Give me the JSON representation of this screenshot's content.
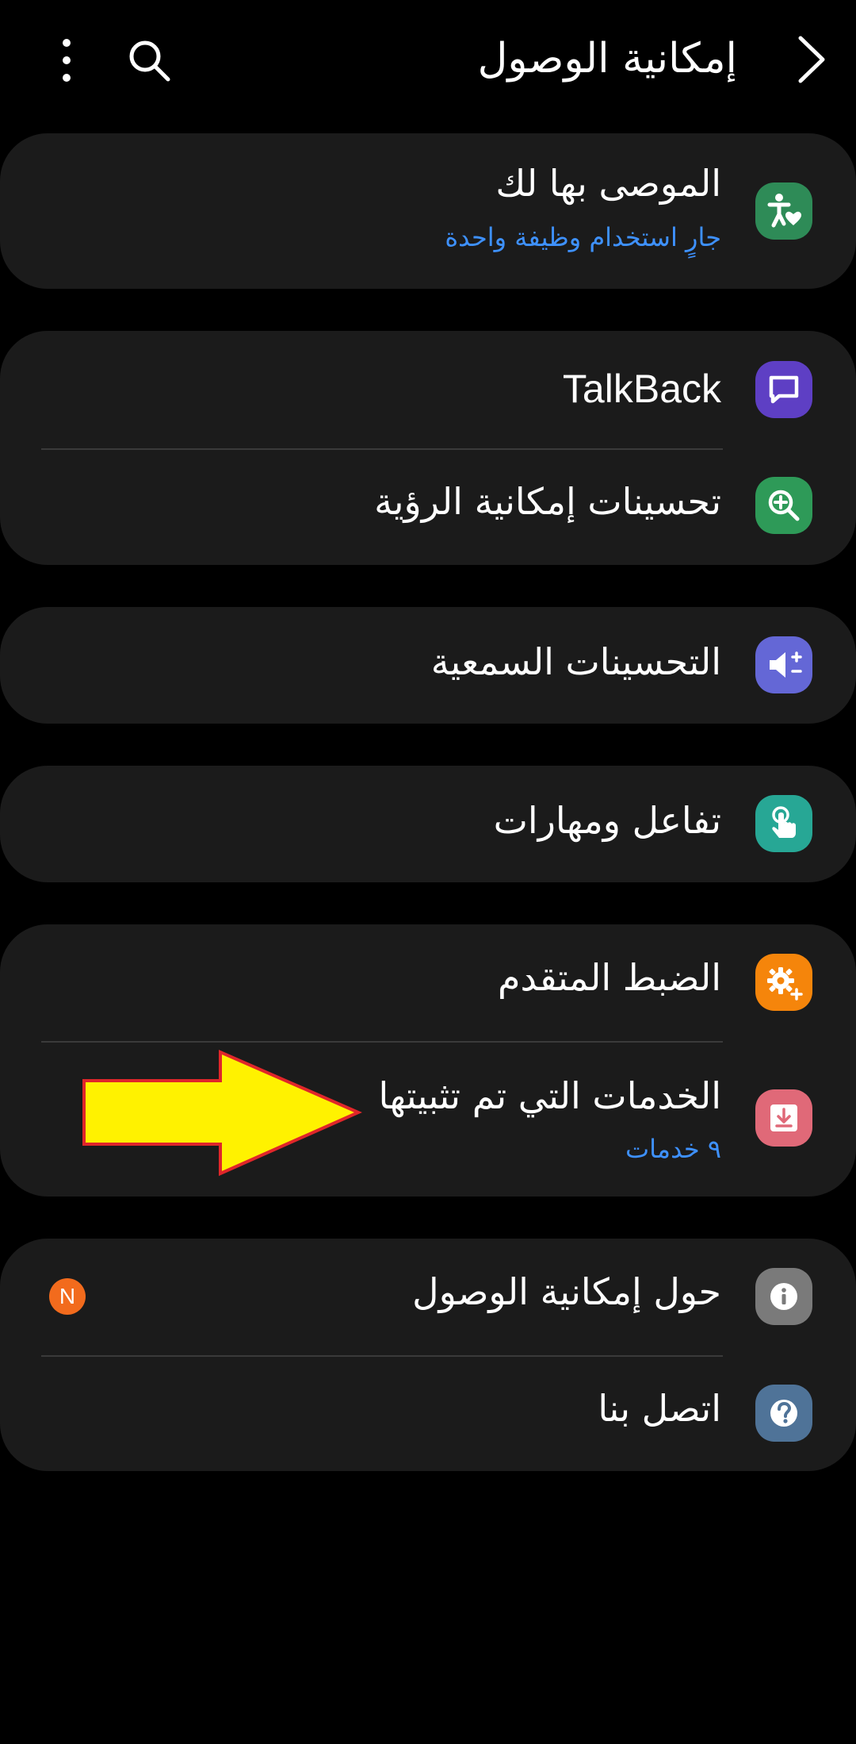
{
  "header": {
    "title": "إمكانية الوصول",
    "back_icon": "chevron-right-icon",
    "search_icon": "search-icon",
    "more_icon": "more-vertical-icon"
  },
  "groups": [
    {
      "items": [
        {
          "label": "الموصى بها لك",
          "subtitle": "جارٍ استخدام وظيفة واحدة",
          "icon": "accessibility-heart-icon",
          "icon_color": "#2e8b57"
        }
      ]
    },
    {
      "items": [
        {
          "label": "TalkBack",
          "icon": "talkback-chat-icon",
          "icon_color": "#5e3fc4"
        },
        {
          "label": "تحسينات إمكانية الرؤية",
          "icon": "zoom-in-icon",
          "icon_color": "#2e9a58"
        }
      ]
    },
    {
      "items": [
        {
          "label": "التحسينات السمعية",
          "icon": "volume-plus-minus-icon",
          "icon_color": "#6467d6"
        }
      ]
    },
    {
      "items": [
        {
          "label": "تفاعل ومهارات",
          "icon": "touch-hand-icon",
          "icon_color": "#27a795"
        }
      ]
    },
    {
      "items": [
        {
          "label": "الضبط المتقدم",
          "icon": "gear-plus-icon",
          "icon_color": "#f5850b"
        },
        {
          "label": "الخدمات التي تم تثبيتها",
          "subtitle": "٩ خدمات",
          "icon": "download-icon",
          "icon_color": "#e06978"
        }
      ]
    },
    {
      "items": [
        {
          "label": "حول إمكانية الوصول",
          "icon": "info-icon",
          "icon_color": "#7a7a7a",
          "badge": "N",
          "badge_color": "#f26b1d"
        },
        {
          "label": "اتصل بنا",
          "icon": "question-icon",
          "icon_color": "#4f7398"
        }
      ]
    }
  ],
  "annotation": {
    "arrow_color": "#fff200",
    "arrow_outline": "#e0262a"
  }
}
